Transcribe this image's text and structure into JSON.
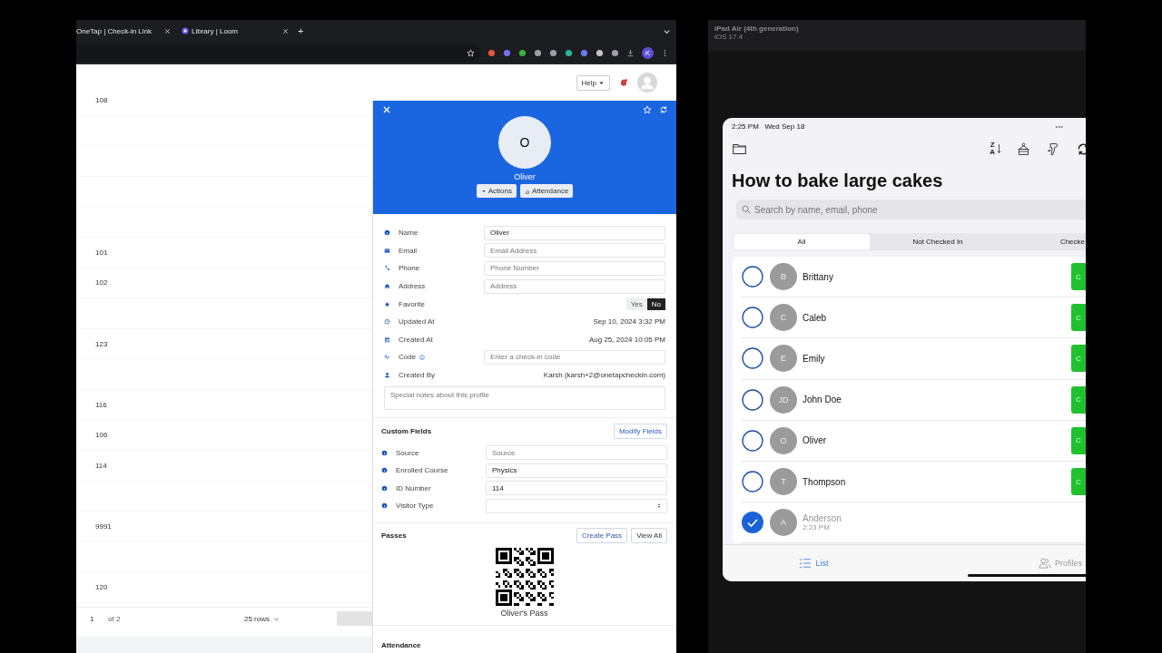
{
  "browser": {
    "tabs": [
      {
        "title": "OneTap | Check-in Link"
      },
      {
        "title": "Library | Loom"
      }
    ],
    "new_tab": "+",
    "profile_initial": "K"
  },
  "page_header": {
    "help": "Help"
  },
  "table": {
    "rows": [
      {
        "column_1": "108"
      },
      {},
      {},
      {},
      {},
      {
        "column_1": "101"
      },
      {
        "column_1": "102"
      },
      {},
      {
        "column_1": "123"
      },
      {},
      {
        "column_1": "116"
      },
      {
        "column_1": "106"
      },
      {
        "column_1": "114"
      },
      {},
      {
        "column_1": "9991"
      },
      {},
      {
        "column_1": "120"
      }
    ]
  },
  "pagination": {
    "page": "1",
    "of": "of 2",
    "rows": "25 rows"
  },
  "profile": {
    "initial": "O",
    "name": "Oliver",
    "actions": [
      "Actions",
      "Attendance"
    ],
    "fields": [
      {
        "label": "Name",
        "kind": "input",
        "value": "Oliver"
      },
      {
        "label": "Email",
        "kind": "input",
        "placeholder": "Email Address"
      },
      {
        "label": "Phone",
        "kind": "input",
        "placeholder": "Phone Number"
      },
      {
        "label": "Address",
        "kind": "input",
        "placeholder": "Address"
      },
      {
        "label": "Favorite",
        "kind": "toggle",
        "options": [
          {
            "label": "Yes",
            "selected": false
          },
          {
            "label": "No",
            "selected": true
          }
        ]
      },
      {
        "label": "Updated At",
        "kind": "text",
        "value": "Sep 10, 2024 3:32 PM"
      },
      {
        "label": "Created At",
        "kind": "text",
        "value": "Aug 25, 2024 10:05 PM"
      },
      {
        "label": "Code",
        "kind": "input",
        "info": true,
        "placeholder": "Enter a check-in code"
      },
      {
        "label": "Created By",
        "kind": "text",
        "value": "Karsh (karsh+2@onetapcheckin.com)"
      }
    ],
    "notes_placeholder": "Special notes about this profile",
    "custom_fields": {
      "title": "Custom Fields",
      "button": "Modify Fields",
      "fields": [
        {
          "label": "Source",
          "kind": "input",
          "placeholder": "Source"
        },
        {
          "label": "Enrolled Course",
          "kind": "input",
          "value": "Physics"
        },
        {
          "label": "ID Number",
          "kind": "input",
          "value": "114"
        },
        {
          "label": "Visitor Type",
          "kind": "select"
        }
      ]
    },
    "passes": {
      "title": "Passes",
      "buttons": [
        "Create Pass",
        "View All"
      ],
      "pass_label": "Oliver's Pass"
    },
    "attendance_title": "Attendance"
  },
  "simulator": {
    "device": "iPad Air (4th generation)",
    "os": "iOS 17.4"
  },
  "ipad": {
    "time": "2:25 PM",
    "date": "Wed Sep 18",
    "more": "•••",
    "sort": [
      "Z",
      "A"
    ],
    "title": "How to bake large cakes",
    "search_placeholder": "Search by name, email, phone",
    "segments": [
      {
        "label": "All",
        "selected": true
      },
      {
        "label": "Not Checked In",
        "selected": false
      },
      {
        "label": "Checke",
        "selected": false
      }
    ],
    "people": [
      {
        "initials": "B",
        "name": "Brittany",
        "checked": false,
        "button": "C"
      },
      {
        "initials": "C",
        "name": "Caleb",
        "checked": false,
        "button": "C"
      },
      {
        "initials": "E",
        "name": "Emily",
        "checked": false,
        "button": "C"
      },
      {
        "initials": "JD",
        "name": "John Doe",
        "checked": false,
        "button": "C"
      },
      {
        "initials": "O",
        "name": "Oliver",
        "checked": false,
        "button": "C"
      },
      {
        "initials": "T",
        "name": "Thompson",
        "checked": false,
        "button": "C"
      },
      {
        "initials": "A",
        "name": "Anderson",
        "checked": true,
        "time": "2:23 PM"
      }
    ],
    "tabs": [
      {
        "label": "List",
        "selected": true
      },
      {
        "label": "Profiles",
        "selected": false
      }
    ]
  }
}
